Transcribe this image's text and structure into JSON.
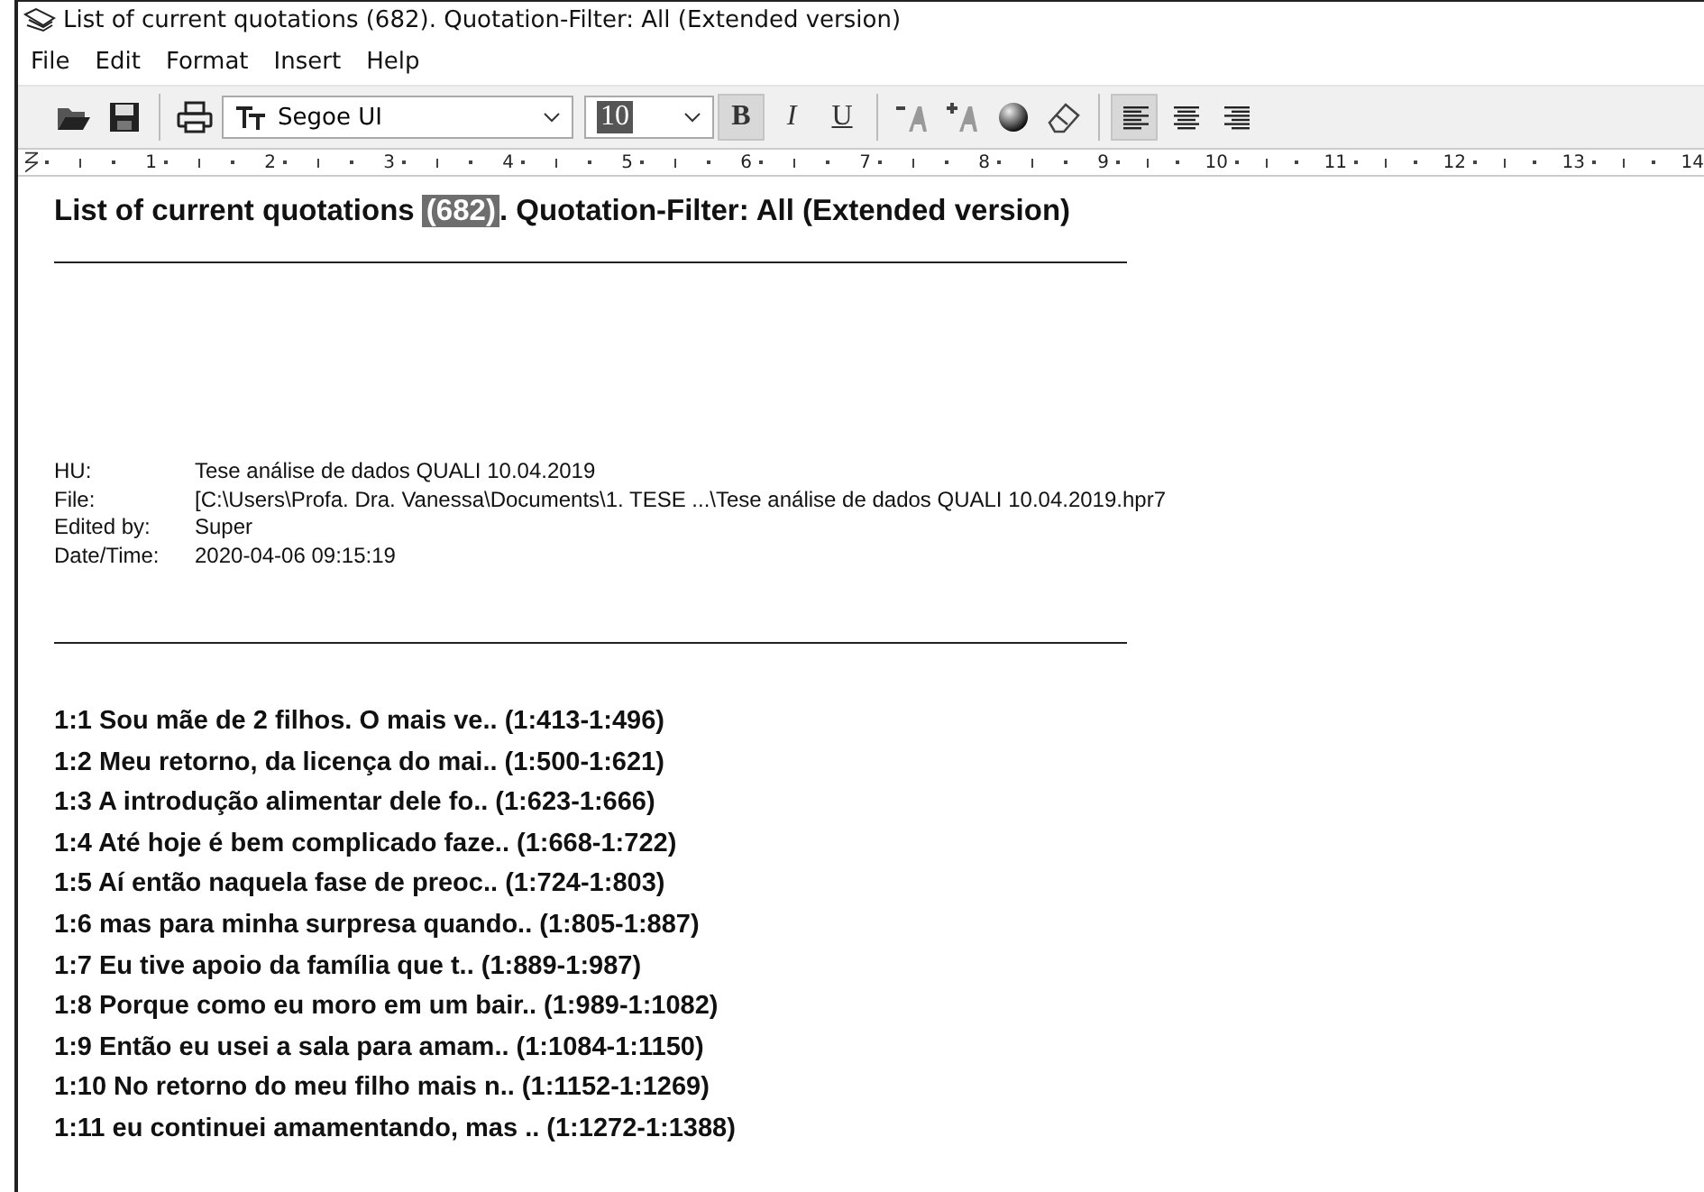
{
  "window": {
    "title": "List of current quotations (682). Quotation-Filter: All (Extended version)"
  },
  "menu": [
    {
      "label": "File"
    },
    {
      "label": "Edit"
    },
    {
      "label": "Format"
    },
    {
      "label": "Insert"
    },
    {
      "label": "Help"
    }
  ],
  "toolbar": {
    "groups": [
      [
        {
          "kind": "open",
          "pressed": false
        },
        {
          "kind": "save",
          "pressed": false
        }
      ],
      [
        {
          "kind": "print",
          "pressed": false
        },
        {
          "kind": "font",
          "text": "Segoe UI"
        },
        {
          "kind": "size",
          "text": "10",
          "selected": true
        },
        {
          "kind": "bold",
          "text": "B",
          "pressed": true
        },
        {
          "kind": "italic",
          "text": "I",
          "pressed": false
        },
        {
          "kind": "underline",
          "text": "U",
          "pressed": false
        }
      ],
      [
        {
          "kind": "shrink",
          "pressed": false
        },
        {
          "kind": "grow",
          "pressed": false
        },
        {
          "kind": "ball",
          "pressed": false
        },
        {
          "kind": "eraser",
          "pressed": false
        }
      ],
      [
        {
          "kind": "left",
          "pressed": true
        },
        {
          "kind": "center",
          "pressed": false
        },
        {
          "kind": "right",
          "pressed": false
        }
      ]
    ]
  },
  "ruler": [
    "1",
    "2",
    "3",
    "4",
    "5",
    "6",
    "7",
    "8",
    "9",
    "10",
    "11",
    "12",
    "13",
    "14"
  ],
  "document": {
    "heading": {
      "before": "List of current quotations ",
      "highlight": "(682)",
      "after": ". Quotation-Filter: All (Extended version)"
    },
    "meta": [
      {
        "label": "HU:",
        "value": "Tese análise de dados QUALI 10.04.2019"
      },
      {
        "label": "File:",
        "value": "[C:\\Users\\Profa. Dra. Vanessa\\Documents\\1. TESE ...\\Tese análise de dados QUALI 10.04.2019.hpr7"
      },
      {
        "label": "Edited by:",
        "value": "Super"
      },
      {
        "label": "Date/Time:",
        "value": "2020-04-06 09:15:19"
      }
    ],
    "quotations": [
      "1:1 Sou mãe de 2 filhos. O mais ve.. (1:413-1:496)",
      "1:2 Meu retorno, da licença do mai.. (1:500-1:621)",
      "1:3 A introdução alimentar dele fo.. (1:623-1:666)",
      "1:4 Até hoje é bem complicado faze.. (1:668-1:722)",
      "1:5 Aí então naquela fase de preoc.. (1:724-1:803)",
      "1:6 mas para minha surpresa quando.. (1:805-1:887)",
      "1:7 Eu tive apoio da família que t.. (1:889-1:987)",
      "1:8 Porque como eu moro em um bair.. (1:989-1:1082)",
      "1:9 Então eu usei a sala para amam.. (1:1084-1:1150)",
      "1:10 No retorno do meu filho mais n.. (1:1152-1:1269)",
      "1:11 eu continuei amamentando, mas .. (1:1272-1:1388)"
    ]
  }
}
